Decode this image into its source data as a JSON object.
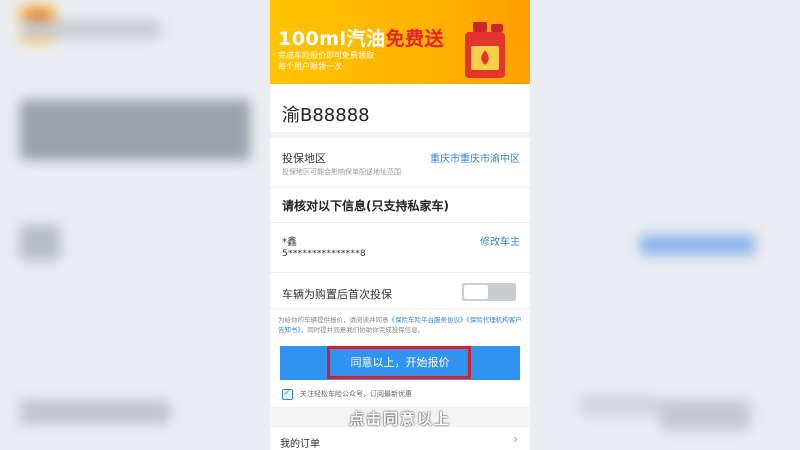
{
  "banner": {
    "title_main": "100ml汽油",
    "title_free": "免费送",
    "line1": "完成车险报价即可免费领取",
    "line2": "每个用户限领一次"
  },
  "plate": "渝B88888",
  "region": {
    "label": "投保地区",
    "value": "重庆市重庆市渝中区",
    "hint": "投保地区可能会影响保单配送地址范围"
  },
  "verify": {
    "title": "请核对以下信息(只支持私家车)",
    "owner_label": "*鑫",
    "owner_edit": "修改车主",
    "owner_id": "5***************8"
  },
  "first_purchase": {
    "label": "车辆为购置后首次投保",
    "enabled": false
  },
  "notice": {
    "prefix": "为给你的车辆提供报价，请阅读并同意",
    "link1": "《保险车险平台服务协议》",
    "link2": "《保险代理机构客户告知书》",
    "suffix": "，同时提并同意我们协助你完成投保信息。"
  },
  "cta_label": "同意以上，开始报价",
  "follow_text": "关注轻松车险公众号，订阅最新优惠",
  "subtitle": "点击同意以上",
  "my_order": "我的订单",
  "colors": {
    "accent_blue": "#2f93ef",
    "highlight_red": "#d4202a",
    "banner_yellow": "#ffc400"
  }
}
